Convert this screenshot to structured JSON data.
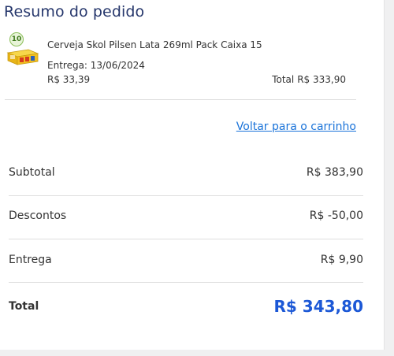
{
  "summary": {
    "title": "Resumo do pedido",
    "item": {
      "quantity_badge": "10",
      "name": "Cerveja Skol Pilsen Lata 269ml Pack Caixa 15",
      "delivery": "Entrega: 13/06/2024",
      "unit_price": "R$ 33,39",
      "total_label": "Total",
      "total_value": "R$ 333,90",
      "thumbnail_icon": "beer-pack-icon"
    },
    "back_link": "Voltar para o carrinho",
    "rows": {
      "subtotal": {
        "label": "Subtotal",
        "value": "R$ 383,90"
      },
      "discounts": {
        "label": "Descontos",
        "value": "R$ -50,00"
      },
      "delivery": {
        "label": "Entrega",
        "value": "R$ 9,90"
      },
      "total": {
        "label": "Total",
        "value": "R$ 343,80"
      }
    }
  },
  "colors": {
    "title": "#25366b",
    "link": "#1a73d9",
    "total": "#1c58d6",
    "badge_border": "#8bbf5a",
    "product_box": "#f2c020"
  }
}
